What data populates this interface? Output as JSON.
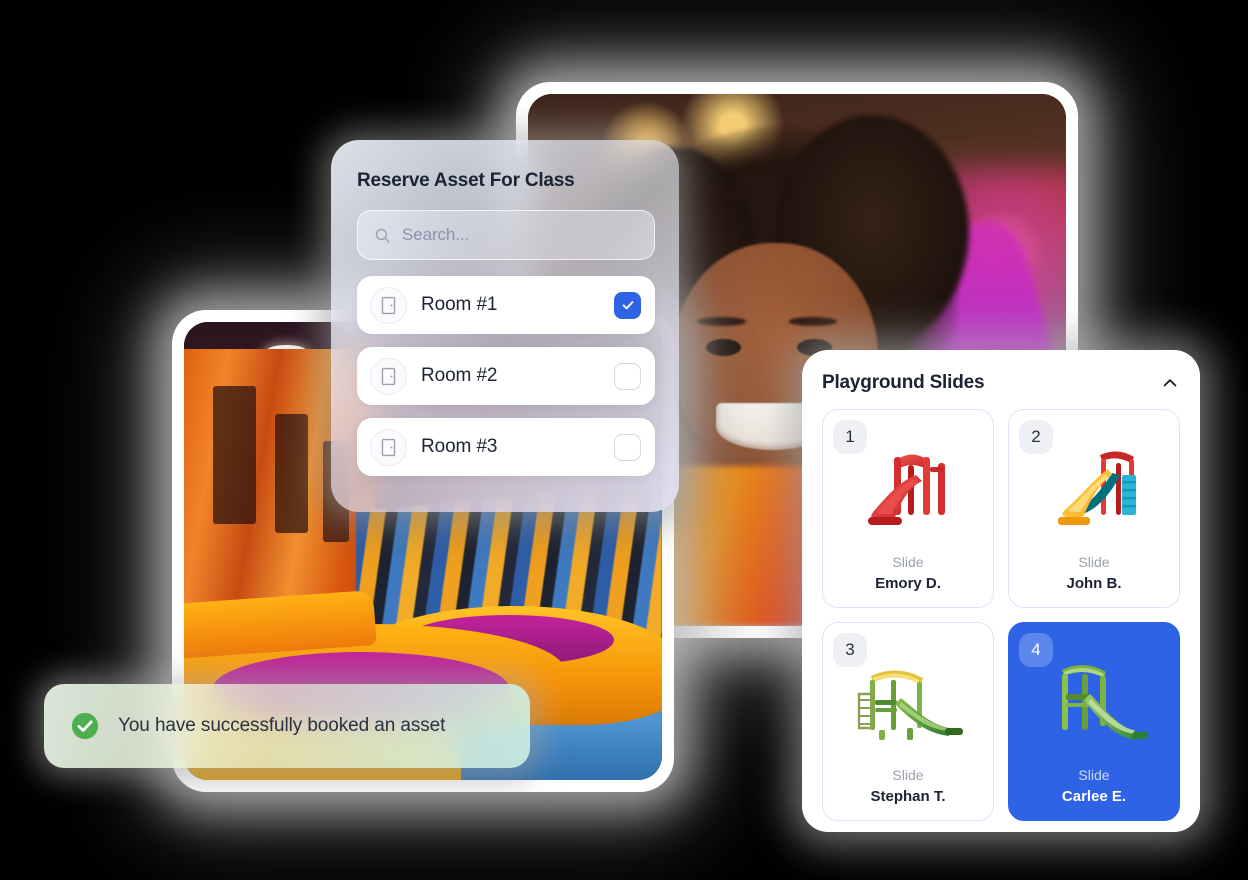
{
  "reserve_modal": {
    "title": "Reserve Asset For Class",
    "search": {
      "placeholder": "Search...",
      "value": "",
      "icon": "search-icon"
    },
    "rooms": [
      {
        "label": "Room #1",
        "icon": "door-icon",
        "checked": true
      },
      {
        "label": "Room #2",
        "icon": "door-icon",
        "checked": false
      },
      {
        "label": "Room #3",
        "icon": "door-icon",
        "checked": false
      }
    ]
  },
  "slides_panel": {
    "title": "Playground Slides",
    "collapse_icon": "chevron-up-icon",
    "cards": [
      {
        "number": "1",
        "kind": "Slide",
        "person": "Emory D.",
        "selected": false,
        "art": "red-slide"
      },
      {
        "number": "2",
        "kind": "Slide",
        "person": "John B.",
        "selected": false,
        "art": "yellow-blue-slide"
      },
      {
        "number": "3",
        "kind": "Slide",
        "person": "Stephan T.",
        "selected": false,
        "art": "green-yellow-slide"
      },
      {
        "number": "4",
        "kind": "Slide",
        "person": "Carlee E.",
        "selected": true,
        "art": "green-slide"
      }
    ]
  },
  "toast": {
    "message": "You have successfully booked an asset",
    "icon": "check-circle-icon"
  },
  "photos": {
    "child": {
      "alt": "Smiling child at indoor playground"
    },
    "bounce_house": {
      "alt": "Indoor bounce house with trampolines"
    }
  },
  "colors": {
    "accent_blue": "#2F63E6",
    "success_green": "#4CAF50",
    "card_border": "#DCE5F8",
    "text_dark": "#1C2434",
    "text_muted": "#9AA1AE",
    "background": "#000000"
  }
}
